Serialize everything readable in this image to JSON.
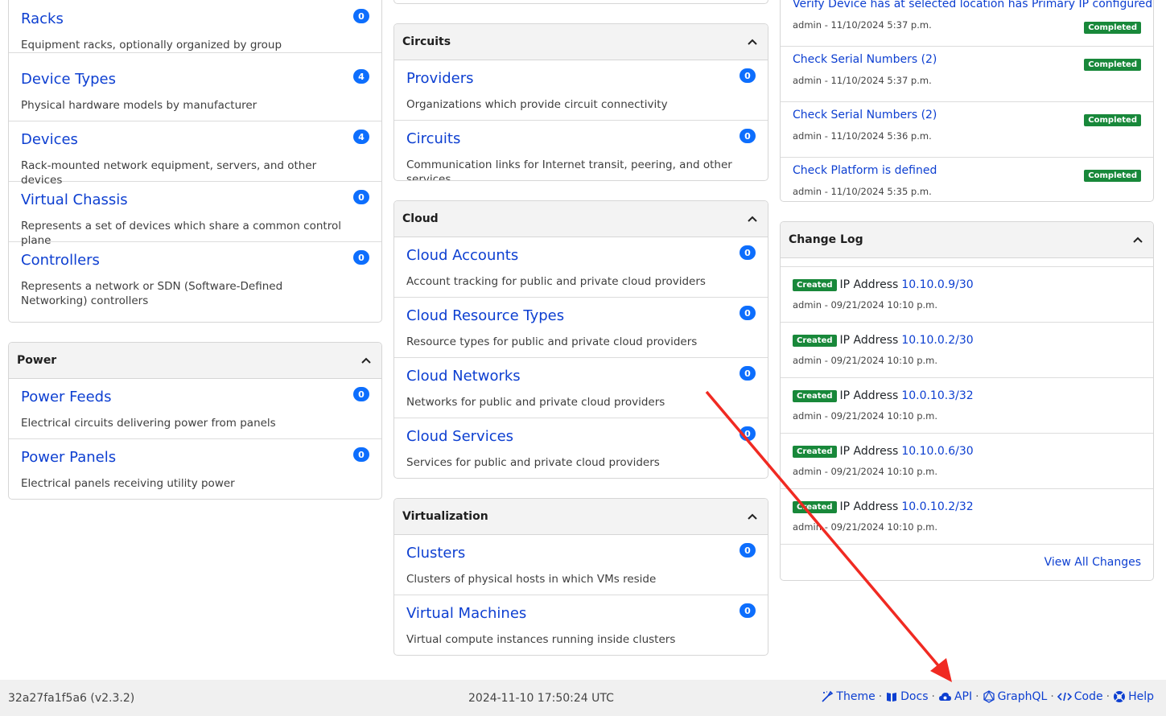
{
  "col1": {
    "organization": [
      {
        "title": "Racks",
        "desc": "Equipment racks, optionally organized by group",
        "count": "0"
      },
      {
        "title": "Device Types",
        "desc": "Physical hardware models by manufacturer",
        "count": "4"
      },
      {
        "title": "Devices",
        "desc": "Rack-mounted network equipment, servers, and other devices",
        "count": "4"
      },
      {
        "title": "Virtual Chassis",
        "desc": "Represents a set of devices which share a common control plane",
        "count": "0"
      },
      {
        "title": "Controllers",
        "desc": "Represents a network or SDN (Software-Defined Networking) controllers",
        "count": "0"
      }
    ],
    "power": {
      "title": "Power",
      "items": [
        {
          "title": "Power Feeds",
          "desc": "Electrical circuits delivering power from panels",
          "count": "0"
        },
        {
          "title": "Power Panels",
          "desc": "Electrical panels receiving utility power",
          "count": "0"
        }
      ]
    }
  },
  "col2": {
    "circuits": {
      "title": "Circuits",
      "items": [
        {
          "title": "Providers",
          "desc": "Organizations which provide circuit connectivity",
          "count": "0"
        },
        {
          "title": "Circuits",
          "desc": "Communication links for Internet transit, peering, and other services",
          "count": "0"
        }
      ]
    },
    "cloud": {
      "title": "Cloud",
      "items": [
        {
          "title": "Cloud Accounts",
          "desc": "Account tracking for public and private cloud providers",
          "count": "0"
        },
        {
          "title": "Cloud Resource Types",
          "desc": "Resource types for public and private cloud providers",
          "count": "0"
        },
        {
          "title": "Cloud Networks",
          "desc": "Networks for public and private cloud providers",
          "count": "0"
        },
        {
          "title": "Cloud Services",
          "desc": "Services for public and private cloud providers",
          "count": "0"
        }
      ]
    },
    "virtualization": {
      "title": "Virtualization",
      "items": [
        {
          "title": "Clusters",
          "desc": "Clusters of physical hosts in which VMs reside",
          "count": "0"
        },
        {
          "title": "Virtual Machines",
          "desc": "Virtual compute instances running inside clusters",
          "count": "0"
        }
      ]
    }
  },
  "col3": {
    "jobs": [
      {
        "name": "Verify Device has at selected location has Primary IP configured",
        "meta": "admin - 11/10/2024 5:37 p.m.",
        "status": "Completed"
      },
      {
        "name": "Check Serial Numbers (2)",
        "meta": "admin - 11/10/2024 5:37 p.m.",
        "status": "Completed"
      },
      {
        "name": "Check Serial Numbers (2)",
        "meta": "admin - 11/10/2024 5:36 p.m.",
        "status": "Completed"
      },
      {
        "name": "Check Platform is defined",
        "meta": "admin - 11/10/2024 5:35 p.m.",
        "status": "Completed"
      }
    ],
    "changelog": {
      "title": "Change Log",
      "entries": [
        {
          "badge": "Created",
          "type": "IP Address",
          "object": "10.10.0.9/30",
          "meta": "admin - 09/21/2024 10:10 p.m."
        },
        {
          "badge": "Created",
          "type": "IP Address",
          "object": "10.10.0.2/30",
          "meta": "admin - 09/21/2024 10:10 p.m."
        },
        {
          "badge": "Created",
          "type": "IP Address",
          "object": "10.0.10.3/32",
          "meta": "admin - 09/21/2024 10:10 p.m."
        },
        {
          "badge": "Created",
          "type": "IP Address",
          "object": "10.10.0.6/30",
          "meta": "admin - 09/21/2024 10:10 p.m."
        },
        {
          "badge": "Created",
          "type": "IP Address",
          "object": "10.0.10.2/32",
          "meta": "admin - 09/21/2024 10:10 p.m."
        }
      ],
      "view_all": "View All Changes"
    }
  },
  "footer": {
    "version": "32a27fa1f5a6 (v2.3.2)",
    "timestamp": "2024-11-10 17:50:24 UTC",
    "links": {
      "theme": "Theme",
      "docs": "Docs",
      "api": "API",
      "graphql": "GraphQL",
      "code": "Code",
      "help": "Help"
    }
  },
  "colors": {
    "link": "#0d3fd1",
    "badge": "#0d6efd",
    "success": "#18883a",
    "annotation_arrow": "#f02a22"
  }
}
